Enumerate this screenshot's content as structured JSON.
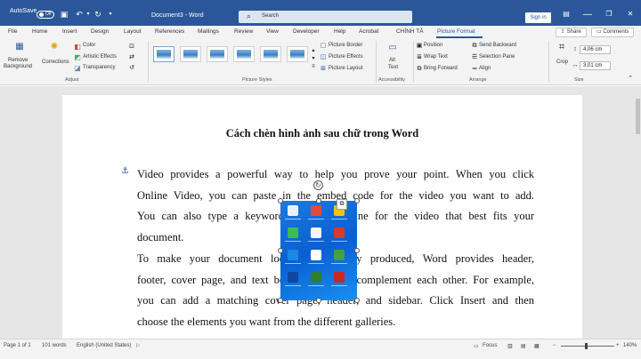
{
  "window": {
    "autosave_label": "AutoSave",
    "autosave_state": "Off",
    "doc_title": "Document3  -  Word",
    "search_placeholder": "Search",
    "signin_label": "Sign in",
    "minimize": "—",
    "restore": "❐",
    "close": "✕"
  },
  "tabs": [
    "File",
    "Home",
    "Insert",
    "Design",
    "Layout",
    "References",
    "Mailings",
    "Review",
    "View",
    "Developer",
    "Help",
    "Acrobat",
    "CHÍNH TẢ",
    "Picture Format"
  ],
  "share_label": "Share",
  "comments_label": "Comments",
  "ribbon": {
    "remove_background": [
      "Remove",
      "Background"
    ],
    "corrections": "Corrections",
    "color": "Color",
    "artistic_effects": "Artistic Effects",
    "transparency": "Transparency",
    "adjust": "Adjust",
    "picture_border": "Picture Border",
    "picture_effects": "Picture Effects",
    "picture_layout": "Picture Layout",
    "picture_styles": "Picture Styles",
    "alt_text": [
      "Alt",
      "Text"
    ],
    "accessibility": "Accessibility",
    "position": "Position",
    "wrap_text": "Wrap Text",
    "bring_forward": "Bring Forward",
    "send_backward": "Send Backward",
    "selection_pane": "Selection Pane",
    "align": "Align",
    "arrange": "Arrange",
    "crop": "Crop",
    "height": "4,06 cm",
    "width": "3,01 cm",
    "size": "Size"
  },
  "document": {
    "title": "Cách chèn hình ảnh sau chữ trong Word",
    "para1": [
      "Video provides a powerful way to help you prove your point. When you click",
      "Online Video, you can paste in the embed code for the video you want to add.",
      "You can also type a keyword to search online for the video that best fits your",
      "document."
    ],
    "para2": [
      "To make your document look professionally produced, Word provides header,",
      "footer, cover page, and text box designs that complement each other. For example,",
      "you can add a matching cover page, header, and sidebar. Click Insert and then",
      "choose the elements you want from the different galleries."
    ]
  },
  "status": {
    "page": "Page 1 of 1",
    "words": "101 words",
    "language": "English (United States)",
    "focus": "Focus",
    "zoom": "140%"
  }
}
